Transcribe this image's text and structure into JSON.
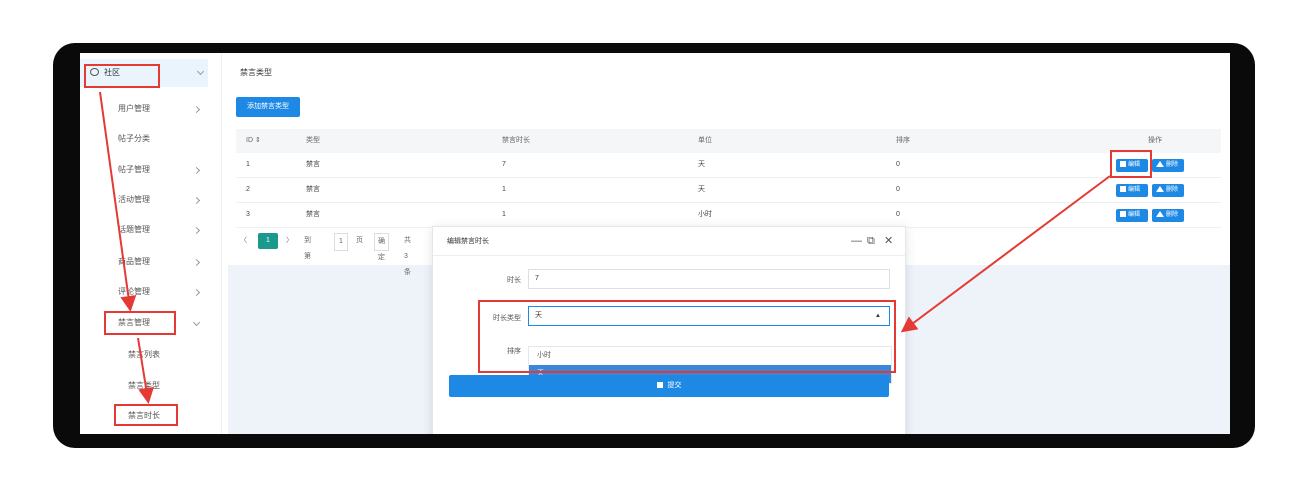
{
  "sidebar": {
    "top_item": "社区",
    "items": [
      {
        "label": "用户管理",
        "arrow": "right"
      },
      {
        "label": "帖子分类",
        "arrow": ""
      },
      {
        "label": "帖子管理",
        "arrow": "right"
      },
      {
        "label": "活动管理",
        "arrow": "right"
      },
      {
        "label": "话题管理",
        "arrow": "right"
      },
      {
        "label": "商品管理",
        "arrow": "right"
      },
      {
        "label": "评论管理",
        "arrow": "right"
      },
      {
        "label": "禁言管理",
        "arrow": "down"
      }
    ],
    "sub_items": [
      "禁言列表",
      "禁言类型",
      "禁言时长"
    ]
  },
  "main": {
    "title": "禁言类型",
    "add_button": "添加禁言类型",
    "table": {
      "headers": [
        "ID ⇕",
        "类型",
        "禁言时长",
        "单位",
        "排序",
        "操作"
      ],
      "rows": [
        [
          "1",
          "禁言",
          "7",
          "天",
          "0"
        ],
        [
          "2",
          "禁言",
          "1",
          "天",
          "0"
        ],
        [
          "3",
          "禁言",
          "1",
          "小时",
          "0"
        ]
      ],
      "edit_label": "编辑",
      "delete_label": "删除"
    },
    "pager": {
      "prev": "〈",
      "current": "1",
      "next": "〉",
      "goto": "到第",
      "page_input": "1",
      "page_unit": "页",
      "confirm": "确定",
      "total": "共 3 条"
    }
  },
  "modal": {
    "title": "编辑禁言时长",
    "minimize": "—",
    "maximize": "⧉",
    "close": "✕",
    "fields": {
      "duration_label": "时长",
      "duration_value": "7",
      "unit_label": "时长类型",
      "unit_value": "天",
      "sort_label": "排序"
    },
    "options": [
      "小时",
      "天"
    ],
    "selected_option": "天",
    "submit": "提交"
  },
  "colors": {
    "primary": "#1e88e5",
    "pager_current": "#1a9a8c",
    "annotation": "#e53935",
    "frame": "#0a0a0a"
  }
}
